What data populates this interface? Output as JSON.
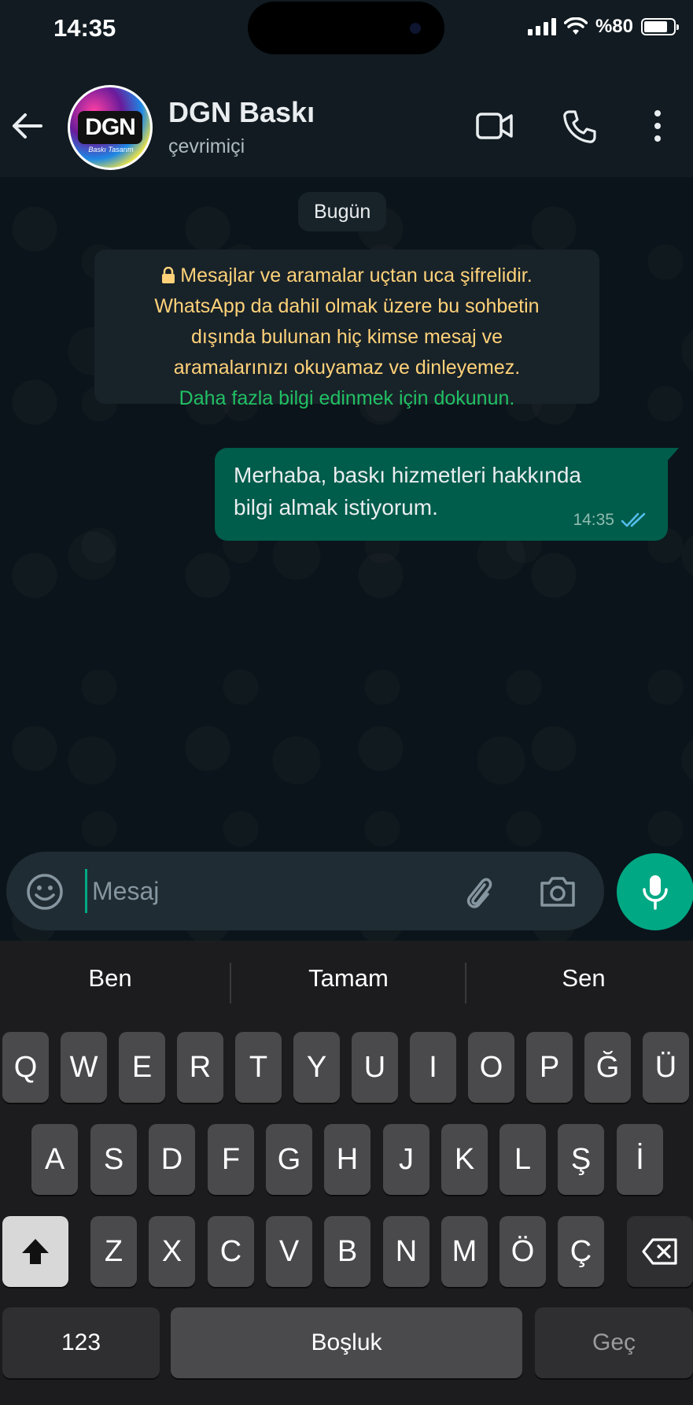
{
  "status_bar": {
    "time": "14:35",
    "battery_text": "%80",
    "battery_level": 0.8
  },
  "header": {
    "contact_name": "DGN Baskı",
    "contact_status": "çevrimiçi",
    "avatar_logo": "DGN",
    "avatar_sub": "Baskı Tasarım"
  },
  "chat": {
    "date_chip": "Bugün",
    "encryption_notice": {
      "lines": [
        "Mesajlar ve aramalar uçtan uca şifrelidir.",
        "WhatsApp da dahil olmak üzere bu sohbetin",
        "dışında bulunan hiç kimse mesaj ve",
        "aramalarınızı okuyamaz ve dinleyemez."
      ],
      "link": "Daha fazla bilgi edinmek için dokunun."
    },
    "messages": [
      {
        "direction": "outgoing",
        "text": "Merhaba, baskı hizmetleri hakkında bilgi almak istiyorum.",
        "time": "14:35",
        "status": "read"
      }
    ]
  },
  "composer": {
    "placeholder": "Mesaj",
    "value": ""
  },
  "keyboard": {
    "suggestions": [
      "Ben",
      "Tamam",
      "Sen"
    ],
    "row1": [
      "Q",
      "W",
      "E",
      "R",
      "T",
      "Y",
      "U",
      "I",
      "O",
      "P",
      "Ğ",
      "Ü"
    ],
    "row2": [
      "A",
      "S",
      "D",
      "F",
      "G",
      "H",
      "J",
      "K",
      "L",
      "Ş",
      "İ"
    ],
    "row3": [
      "Z",
      "X",
      "C",
      "V",
      "B",
      "N",
      "M",
      "Ö",
      "Ç"
    ],
    "numbers_key": "123",
    "space_key": "Boşluk",
    "return_key": "Geç"
  },
  "colors": {
    "accent": "#00a884",
    "bubble_out": "#005c4b",
    "notice_text": "#ffd279",
    "link": "#21c063",
    "read_ticks": "#53bdeb"
  },
  "icons": [
    "back-arrow-icon",
    "video-call-icon",
    "voice-call-icon",
    "more-vert-icon",
    "lock-icon",
    "double-check-icon",
    "emoji-icon",
    "attach-icon",
    "camera-icon",
    "mic-icon",
    "shift-icon",
    "backspace-icon"
  ]
}
